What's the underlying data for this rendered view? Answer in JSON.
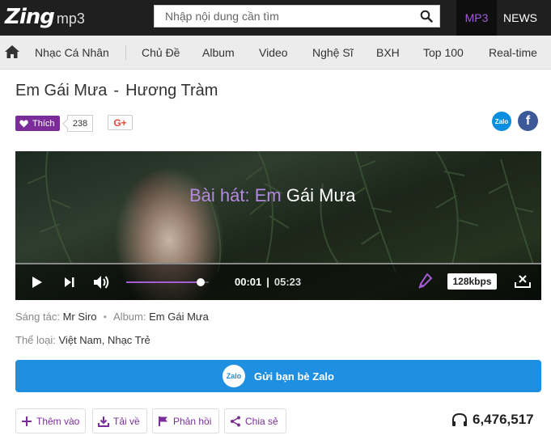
{
  "header": {
    "logo_brand": "Zing",
    "logo_suffix": "mp3",
    "search_placeholder": "Nhập nội dung cần tìm",
    "tabs": [
      "MP3",
      "NEWS"
    ],
    "active_tab": "MP3",
    "accent_color": "#a35cd6"
  },
  "nav": {
    "items": [
      "Nhạc Cá Nhân",
      "Chủ Đề",
      "Album",
      "Video",
      "Nghệ Sĩ",
      "BXH",
      "Top 100",
      "Real-time"
    ]
  },
  "song": {
    "title": "Em Gái Mưa",
    "separator": "-",
    "artist": "Hương Tràm"
  },
  "social": {
    "like_label": "Thích",
    "like_count": "238",
    "gplus_label": "G+",
    "zalo_label": "Zalo",
    "fb_label": "f"
  },
  "player": {
    "caption_prefix": "Bài hát: Em",
    "caption_suffix": " Gái Mưa",
    "time_current": "00:01",
    "time_separator": "|",
    "time_total": "05:23",
    "quality": "128kbps",
    "volume_fraction": 0.9,
    "progress_fraction": 0.0
  },
  "meta": {
    "composer_label": "Sáng tác:",
    "composer": "Mr Siro",
    "album_label": "Album:",
    "album": "Em Gái Mưa",
    "genre_label": "Thể loại:",
    "genres": "Việt Nam, Nhạc Trẻ"
  },
  "zalo_send": {
    "icon_label": "Zalo",
    "label": "Gửi bạn bè Zalo"
  },
  "actions": {
    "add": "Thêm vào",
    "download": "Tải về",
    "feedback": "Phản hồi",
    "share": "Chia sẻ"
  },
  "listen_count": "6,476,517"
}
